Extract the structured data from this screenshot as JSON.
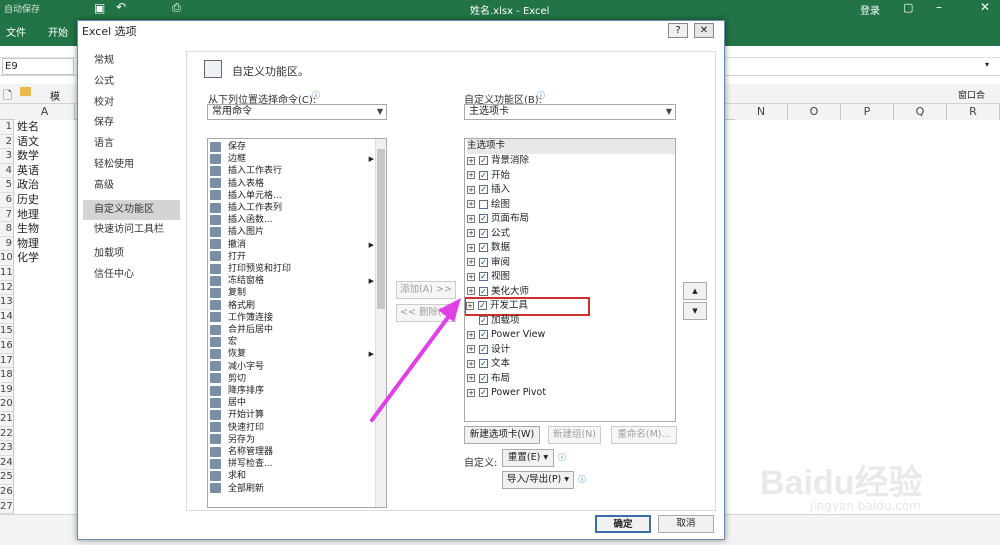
{
  "excel": {
    "autosave": "自动保存",
    "file_title": "姓名.xlsx - Excel",
    "login": "登录",
    "tab_file": "文件",
    "tab_home": "开始",
    "name_box": "E9",
    "window_label": "窗口合",
    "col_a": "A",
    "columns": [
      "N",
      "O",
      "P",
      "Q",
      "R"
    ],
    "rows": [
      {
        "n": "1",
        "v": "姓名"
      },
      {
        "n": "2",
        "v": "语文"
      },
      {
        "n": "3",
        "v": "数学"
      },
      {
        "n": "4",
        "v": "英语"
      },
      {
        "n": "5",
        "v": "政治"
      },
      {
        "n": "6",
        "v": "历史"
      },
      {
        "n": "7",
        "v": "地理"
      },
      {
        "n": "8",
        "v": "生物"
      },
      {
        "n": "9",
        "v": "物理"
      },
      {
        "n": "10",
        "v": "化学"
      },
      {
        "n": "11",
        "v": ""
      },
      {
        "n": "12",
        "v": ""
      },
      {
        "n": "13",
        "v": ""
      },
      {
        "n": "14",
        "v": ""
      },
      {
        "n": "15",
        "v": ""
      },
      {
        "n": "16",
        "v": ""
      },
      {
        "n": "17",
        "v": ""
      },
      {
        "n": "18",
        "v": ""
      },
      {
        "n": "19",
        "v": ""
      },
      {
        "n": "20",
        "v": ""
      },
      {
        "n": "21",
        "v": ""
      },
      {
        "n": "22",
        "v": ""
      },
      {
        "n": "23",
        "v": ""
      },
      {
        "n": "24",
        "v": ""
      },
      {
        "n": "25",
        "v": ""
      },
      {
        "n": "26",
        "v": ""
      },
      {
        "n": "27",
        "v": ""
      }
    ],
    "accent": "#227447"
  },
  "dialog": {
    "title": "Excel 选项",
    "help": "?",
    "close": "✕",
    "nav": [
      "常规",
      "公式",
      "校对",
      "保存",
      "语言",
      "轻松使用",
      "高级",
      "自定义功能区",
      "快速访问工具栏",
      "加载项",
      "信任中心"
    ],
    "nav_selected": 7,
    "heading": "自定义功能区。",
    "left_label": "从下列位置选择命令(C):",
    "left_select": "常用命令",
    "commands": [
      {
        "t": "保存",
        "s": false
      },
      {
        "t": "边框",
        "s": true
      },
      {
        "t": "插入工作表行",
        "s": false
      },
      {
        "t": "插入表格",
        "s": false
      },
      {
        "t": "插入单元格...",
        "s": false
      },
      {
        "t": "插入工作表列",
        "s": false
      },
      {
        "t": "插入函数...",
        "s": false
      },
      {
        "t": "插入图片",
        "s": false
      },
      {
        "t": "撤消",
        "s": true
      },
      {
        "t": "打开",
        "s": false
      },
      {
        "t": "打印预览和打印",
        "s": false
      },
      {
        "t": "冻结窗格",
        "s": true
      },
      {
        "t": "复制",
        "s": false
      },
      {
        "t": "格式刷",
        "s": false
      },
      {
        "t": "工作簿连接",
        "s": false
      },
      {
        "t": "合并后居中",
        "s": false
      },
      {
        "t": "宏",
        "s": false
      },
      {
        "t": "恢复",
        "s": true
      },
      {
        "t": "减小字号",
        "s": false
      },
      {
        "t": "剪切",
        "s": false
      },
      {
        "t": "降序排序",
        "s": false
      },
      {
        "t": "居中",
        "s": false
      },
      {
        "t": "开始计算",
        "s": false
      },
      {
        "t": "快速打印",
        "s": false
      },
      {
        "t": "另存为",
        "s": false
      },
      {
        "t": "名称管理器",
        "s": false
      },
      {
        "t": "拼写检查...",
        "s": false
      },
      {
        "t": "求和",
        "s": false
      },
      {
        "t": "全部刷新",
        "s": false
      }
    ],
    "add_btn": "添加(A) >>",
    "remove_btn": "<< 删除(R)",
    "right_label": "自定义功能区(B):",
    "right_select": "主选项卡",
    "tree_header": "主选项卡",
    "tabs": [
      {
        "t": "背景消除",
        "plus": true
      },
      {
        "t": "开始",
        "plus": true
      },
      {
        "t": "插入",
        "plus": true
      },
      {
        "t": "绘图",
        "plus": true,
        "unchecked": true
      },
      {
        "t": "页面布局",
        "plus": true
      },
      {
        "t": "公式",
        "plus": true
      },
      {
        "t": "数据",
        "plus": true
      },
      {
        "t": "审阅",
        "plus": true
      },
      {
        "t": "视图",
        "plus": true
      },
      {
        "t": "美化大师",
        "plus": true
      },
      {
        "t": "开发工具",
        "plus": true
      },
      {
        "t": "加载项",
        "plus": false
      },
      {
        "t": "Power View",
        "plus": true
      },
      {
        "t": "设计",
        "plus": true
      },
      {
        "t": "文本",
        "plus": true
      },
      {
        "t": "布局",
        "plus": true
      },
      {
        "t": "Power Pivot",
        "plus": true
      }
    ],
    "highlight_index": 10,
    "highlight_color": "#d0302d",
    "arrow_color": "#e040e6",
    "new_tab_btn": "新建选项卡(W)",
    "new_group_btn": "新建组(N)",
    "rename_btn": "重命名(M)...",
    "customize_label": "自定义:",
    "reset_btn": "重置(E) ▾",
    "import_btn": "导入/导出(P) ▾",
    "ok_btn": "确定",
    "cancel_btn": "取消"
  },
  "watermark": {
    "brand": "Baidu经验",
    "url": "jingyan.baidu.com"
  }
}
